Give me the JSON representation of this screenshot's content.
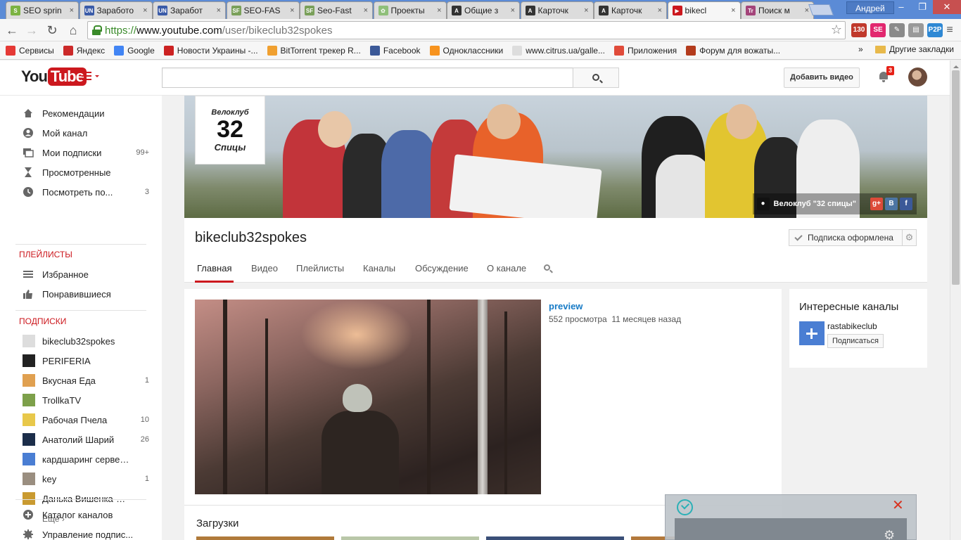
{
  "browser": {
    "tabs": [
      {
        "title": "SEO sprin",
        "fav_text": "S",
        "fav_color": "#7cb342"
      },
      {
        "title": "Заработо",
        "fav_text": "UN",
        "fav_color": "#3a5ba8"
      },
      {
        "title": "Заработ",
        "fav_text": "UN",
        "fav_color": "#3a5ba8"
      },
      {
        "title": "SEO-FAS",
        "fav_text": "SF",
        "fav_color": "#7aa05a"
      },
      {
        "title": "Seo-Fast",
        "fav_text": "SF",
        "fav_color": "#7aa05a"
      },
      {
        "title": "Проекты",
        "fav_text": "✿",
        "fav_color": "#8fbf7a"
      },
      {
        "title": "Общие з",
        "fav_text": "A",
        "fav_color": "#333333"
      },
      {
        "title": "Карточк",
        "fav_text": "A",
        "fav_color": "#333333"
      },
      {
        "title": "Карточк",
        "fav_text": "A",
        "fav_color": "#333333"
      },
      {
        "title": "bikecl",
        "fav_text": "▶",
        "fav_color": "#cc181e",
        "active": true
      },
      {
        "title": "Поиск м",
        "fav_text": "Tr",
        "fav_color": "#a4447a"
      }
    ],
    "profile_name": "Андрей",
    "window_controls": [
      "–",
      "❐",
      "✕"
    ],
    "url_protocol": "https://",
    "url_host": "www.youtube.com",
    "url_path": "/user/bikeclub32spokes",
    "extensions": [
      {
        "label": "130",
        "color": "#c0392b"
      },
      {
        "label": "SE",
        "color": "#e2286f"
      },
      {
        "label": "✎",
        "color": "#8a8a8a"
      },
      {
        "label": "▤",
        "color": "#999999"
      },
      {
        "label": "P2P",
        "color": "#2e88d4"
      }
    ],
    "bookmarks": [
      {
        "label": "Сервисы",
        "icon_color": "#e53935"
      },
      {
        "label": "Яндекс",
        "icon_color": "#cc2a2a"
      },
      {
        "label": "Google",
        "icon_color": "#4285f4"
      },
      {
        "label": "Новости Украины -...",
        "icon_color": "#cc2222"
      },
      {
        "label": "BitTorrent трекер R...",
        "icon_color": "#f0a030"
      },
      {
        "label": "Facebook",
        "icon_color": "#3b5998"
      },
      {
        "label": "Одноклассники",
        "icon_color": "#f7931e"
      },
      {
        "label": "www.citrus.ua/galle...",
        "icon_color": "#dddddd"
      },
      {
        "label": "Приложения",
        "icon_color": "#e04b3a"
      },
      {
        "label": "Форум для вожаты...",
        "icon_color": "#b33b1c"
      }
    ],
    "bookmarks_more": "»",
    "other_bookmarks": "Другие закладки"
  },
  "youtube": {
    "logo_you": "You",
    "logo_tube": "Tube",
    "upload_label": "Добавить видео",
    "notification_count": "3",
    "guide": {
      "main": [
        {
          "label": "Рекомендации",
          "icon": "home-icon",
          "count": ""
        },
        {
          "label": "Мой канал",
          "icon": "person-icon",
          "count": ""
        },
        {
          "label": "Мои подписки",
          "icon": "subscriptions-icon",
          "count": "99+"
        },
        {
          "label": "Просмотренные",
          "icon": "hourglass-icon",
          "count": ""
        },
        {
          "label": "Посмотреть по...",
          "icon": "clock-icon",
          "count": "3"
        }
      ],
      "playlists_title": "ПЛЕЙЛИСТЫ",
      "playlists": [
        {
          "label": "Избранное",
          "icon": "list-icon"
        },
        {
          "label": "Понравившиеся",
          "icon": "thumbs-up-icon"
        }
      ],
      "subscriptions_title": "ПОДПИСКИ",
      "subscriptions": [
        {
          "label": "bikeclub32spokes",
          "count": "",
          "color": "#dddddd"
        },
        {
          "label": "PERIFERIA",
          "count": "",
          "color": "#222222"
        },
        {
          "label": "Вкусная Еда",
          "count": "1",
          "color": "#e0a050"
        },
        {
          "label": "TrollkaTV",
          "count": "",
          "color": "#7da04a"
        },
        {
          "label": "Рабочая Пчела",
          "count": "10",
          "color": "#e8c84a"
        },
        {
          "label": "Анатолий Шарий",
          "count": "26",
          "color": "#1c2e4a"
        },
        {
          "label": "кардшаринг сервер ...",
          "count": "",
          "color": "#4a7ed3"
        },
        {
          "label": "key",
          "count": "1",
          "color": "#9a8e80"
        },
        {
          "label": "Данька Вишенка-Че...",
          "count": "",
          "color": "#c99a30"
        }
      ],
      "more_label": "Ещё ›",
      "bottom": [
        {
          "label": "Каталог каналов",
          "icon": "add-circle-icon"
        },
        {
          "label": "Управление подпис...",
          "icon": "gear-icon"
        }
      ]
    },
    "channel": {
      "logo_line1": "Велоклуб",
      "logo_line2": "32",
      "logo_line3": "Спицы",
      "banner_link_text": "Велоклуб \"32 спицы\"",
      "social": [
        {
          "label": "g+",
          "color": "#dd4b39"
        },
        {
          "label": "B",
          "color": "#4c75a3"
        },
        {
          "label": "f",
          "color": "#3b5998"
        }
      ],
      "name": "bikeclub32spokes",
      "subscribed_label": "Подписка оформлена",
      "tabs": [
        "Главная",
        "Видео",
        "Плейлисты",
        "Каналы",
        "Обсуждение",
        "О канале"
      ],
      "video_title": "preview",
      "video_views": "552 просмотра",
      "video_age": "11 месяцев назад",
      "uploads_title": "Загрузки",
      "related_title": "Интересные каналы",
      "related_channel": "rastabikeclub",
      "related_subscribe": "Подписаться"
    }
  }
}
